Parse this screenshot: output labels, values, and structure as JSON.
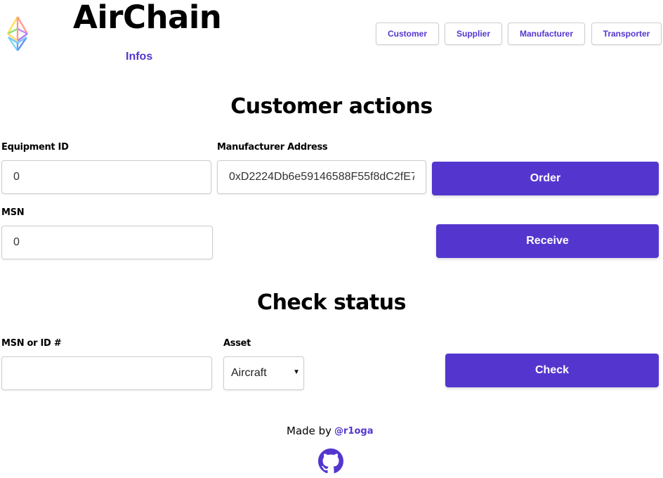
{
  "header": {
    "logo_icon": "ethereum-rainbow-icon",
    "brand_title": "AirChain",
    "infos_link": "Infos",
    "nav": [
      {
        "label": "Customer"
      },
      {
        "label": "Supplier"
      },
      {
        "label": "Manufacturer"
      },
      {
        "label": "Transporter"
      }
    ]
  },
  "customer_actions": {
    "title": "Customer actions",
    "equipment_id": {
      "label": "Equipment ID",
      "value": "0"
    },
    "manufacturer_address": {
      "label": "Manufacturer Address",
      "value": "0xD2224Db6e59146588F55f8dC2fE7"
    },
    "order_button": "Order",
    "msn": {
      "label": "MSN",
      "value": "0"
    },
    "receive_button": "Receive"
  },
  "check_status": {
    "title": "Check status",
    "msn_or_id": {
      "label": "MSN or ID #",
      "value": ""
    },
    "asset": {
      "label": "Asset",
      "selected": "Aircraft"
    },
    "check_button": "Check"
  },
  "footer": {
    "made_by": "Made by",
    "handle": "@r1oga",
    "github_icon": "github-icon"
  },
  "colors": {
    "accent": "#5436cf",
    "background": "#ffffff",
    "input_border": "#cdcdcd"
  }
}
